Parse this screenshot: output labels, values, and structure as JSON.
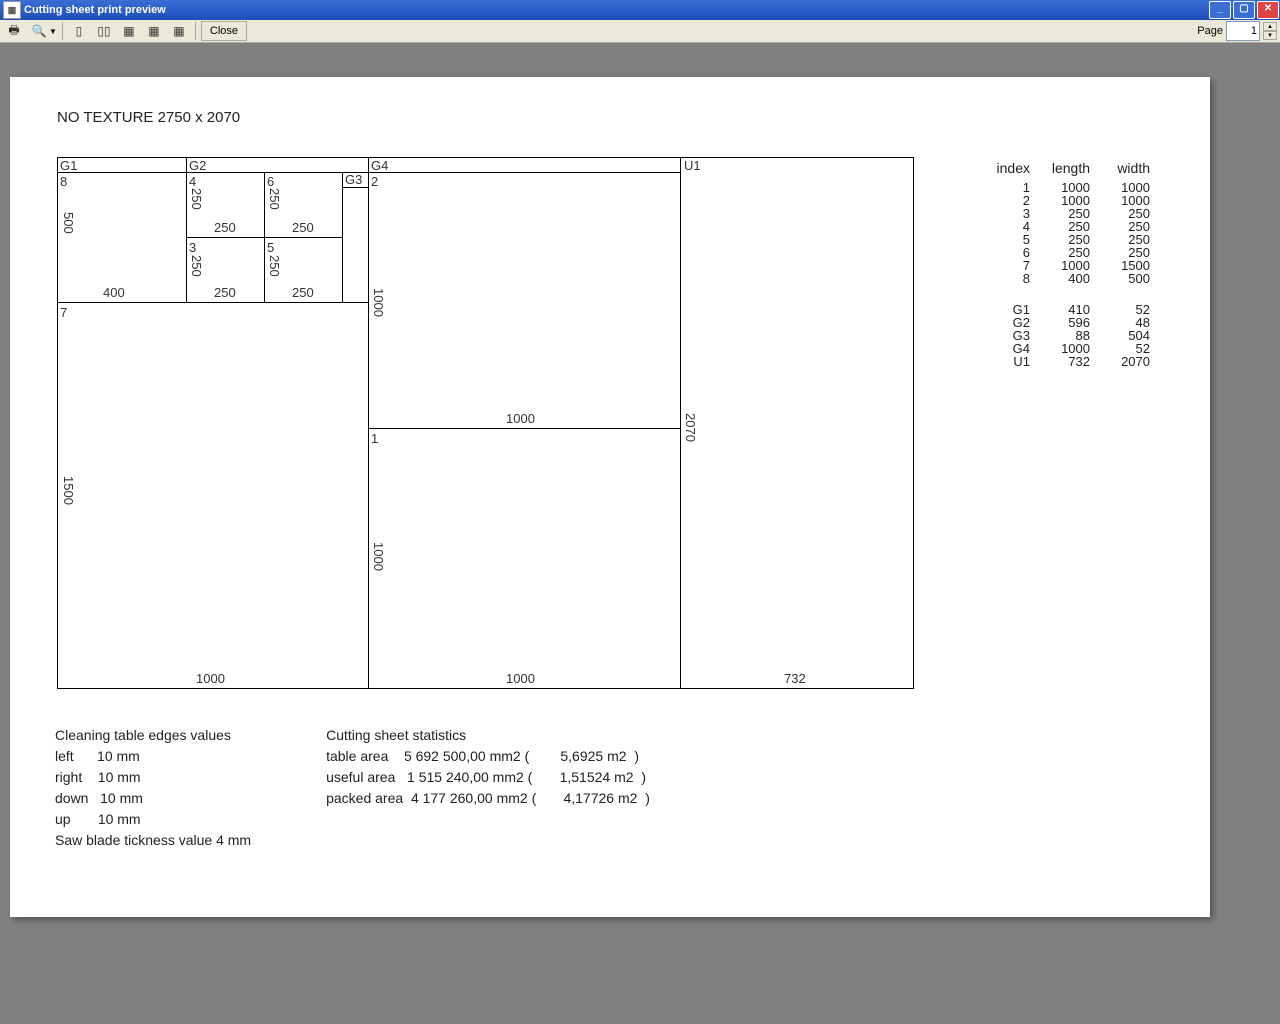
{
  "window": {
    "title": "Cutting sheet print preview"
  },
  "toolbar": {
    "close": "Close",
    "page_label": "Page",
    "page_value": "1"
  },
  "sheet": {
    "title": "NO TEXTURE 2750 x 2070"
  },
  "gutters": {
    "G1": "G1",
    "G2": "G2",
    "G3": "G3",
    "G4": "G4",
    "U1": "U1"
  },
  "pieces": {
    "8": {
      "idx": "8",
      "w": "400",
      "h": "500"
    },
    "4": {
      "idx": "4",
      "w": "250",
      "h": "250"
    },
    "6": {
      "idx": "6",
      "w": "250",
      "h": "250"
    },
    "3": {
      "idx": "3",
      "w": "250",
      "h": "250"
    },
    "5": {
      "idx": "5",
      "w": "250",
      "h": "250"
    },
    "2": {
      "idx": "2",
      "w": "1000",
      "h": "1000"
    },
    "1": {
      "idx": "1",
      "w": "1000",
      "h": "1000"
    },
    "7": {
      "idx": "7",
      "w": "1000",
      "h": "1500"
    }
  },
  "dims": {
    "col1": "1000",
    "col2": "1000",
    "col3": "732",
    "side": "2070"
  },
  "table": {
    "headers": {
      "index": "index",
      "length": "length",
      "width": "width"
    },
    "rows1": [
      {
        "i": "1",
        "l": "1000",
        "w": "1000"
      },
      {
        "i": "2",
        "l": "1000",
        "w": "1000"
      },
      {
        "i": "3",
        "l": "250",
        "w": "250"
      },
      {
        "i": "4",
        "l": "250",
        "w": "250"
      },
      {
        "i": "5",
        "l": "250",
        "w": "250"
      },
      {
        "i": "6",
        "l": "250",
        "w": "250"
      },
      {
        "i": "7",
        "l": "1000",
        "w": "1500"
      },
      {
        "i": "8",
        "l": "400",
        "w": "500"
      }
    ],
    "rows2": [
      {
        "i": "G1",
        "l": "410",
        "w": "52"
      },
      {
        "i": "G2",
        "l": "596",
        "w": "48"
      },
      {
        "i": "G3",
        "l": "88",
        "w": "504"
      },
      {
        "i": "G4",
        "l": "1000",
        "w": "52"
      },
      {
        "i": "U1",
        "l": "732",
        "w": "2070"
      }
    ]
  },
  "edges": {
    "title": "Cleaning table edges values",
    "left_label": "left",
    "left_val": "10 mm",
    "right_label": "right",
    "right_val": "10 mm",
    "down_label": "down",
    "down_val": "10 mm",
    "up_label": "up",
    "up_val": "10 mm",
    "saw": "Saw blade tickness value 4 mm"
  },
  "stats": {
    "title": "Cutting sheet statistics",
    "ta_label": "table area",
    "ta_mm": "5 692 500,00 mm2 (",
    "ta_m": "5,6925 m2",
    "ta_close": ")",
    "ua_label": "useful area",
    "ua_mm": "1 515 240,00 mm2 (",
    "ua_m": "1,51524 m2",
    "ua_close": ")",
    "pa_label": "packed area",
    "pa_mm": "4 177 260,00 mm2 (",
    "pa_m": "4,17726 m2",
    "pa_close": ")"
  }
}
